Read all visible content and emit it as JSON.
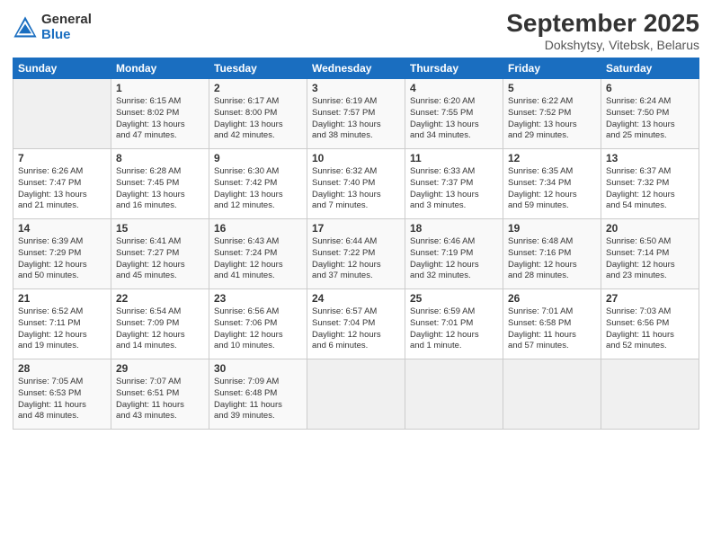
{
  "logo": {
    "general": "General",
    "blue": "Blue"
  },
  "title": "September 2025",
  "location": "Dokshytsy, Vitebsk, Belarus",
  "headers": [
    "Sunday",
    "Monday",
    "Tuesday",
    "Wednesday",
    "Thursday",
    "Friday",
    "Saturday"
  ],
  "weeks": [
    [
      {
        "day": "",
        "content": ""
      },
      {
        "day": "1",
        "content": "Sunrise: 6:15 AM\nSunset: 8:02 PM\nDaylight: 13 hours\nand 47 minutes."
      },
      {
        "day": "2",
        "content": "Sunrise: 6:17 AM\nSunset: 8:00 PM\nDaylight: 13 hours\nand 42 minutes."
      },
      {
        "day": "3",
        "content": "Sunrise: 6:19 AM\nSunset: 7:57 PM\nDaylight: 13 hours\nand 38 minutes."
      },
      {
        "day": "4",
        "content": "Sunrise: 6:20 AM\nSunset: 7:55 PM\nDaylight: 13 hours\nand 34 minutes."
      },
      {
        "day": "5",
        "content": "Sunrise: 6:22 AM\nSunset: 7:52 PM\nDaylight: 13 hours\nand 29 minutes."
      },
      {
        "day": "6",
        "content": "Sunrise: 6:24 AM\nSunset: 7:50 PM\nDaylight: 13 hours\nand 25 minutes."
      }
    ],
    [
      {
        "day": "7",
        "content": "Sunrise: 6:26 AM\nSunset: 7:47 PM\nDaylight: 13 hours\nand 21 minutes."
      },
      {
        "day": "8",
        "content": "Sunrise: 6:28 AM\nSunset: 7:45 PM\nDaylight: 13 hours\nand 16 minutes."
      },
      {
        "day": "9",
        "content": "Sunrise: 6:30 AM\nSunset: 7:42 PM\nDaylight: 13 hours\nand 12 minutes."
      },
      {
        "day": "10",
        "content": "Sunrise: 6:32 AM\nSunset: 7:40 PM\nDaylight: 13 hours\nand 7 minutes."
      },
      {
        "day": "11",
        "content": "Sunrise: 6:33 AM\nSunset: 7:37 PM\nDaylight: 13 hours\nand 3 minutes."
      },
      {
        "day": "12",
        "content": "Sunrise: 6:35 AM\nSunset: 7:34 PM\nDaylight: 12 hours\nand 59 minutes."
      },
      {
        "day": "13",
        "content": "Sunrise: 6:37 AM\nSunset: 7:32 PM\nDaylight: 12 hours\nand 54 minutes."
      }
    ],
    [
      {
        "day": "14",
        "content": "Sunrise: 6:39 AM\nSunset: 7:29 PM\nDaylight: 12 hours\nand 50 minutes."
      },
      {
        "day": "15",
        "content": "Sunrise: 6:41 AM\nSunset: 7:27 PM\nDaylight: 12 hours\nand 45 minutes."
      },
      {
        "day": "16",
        "content": "Sunrise: 6:43 AM\nSunset: 7:24 PM\nDaylight: 12 hours\nand 41 minutes."
      },
      {
        "day": "17",
        "content": "Sunrise: 6:44 AM\nSunset: 7:22 PM\nDaylight: 12 hours\nand 37 minutes."
      },
      {
        "day": "18",
        "content": "Sunrise: 6:46 AM\nSunset: 7:19 PM\nDaylight: 12 hours\nand 32 minutes."
      },
      {
        "day": "19",
        "content": "Sunrise: 6:48 AM\nSunset: 7:16 PM\nDaylight: 12 hours\nand 28 minutes."
      },
      {
        "day": "20",
        "content": "Sunrise: 6:50 AM\nSunset: 7:14 PM\nDaylight: 12 hours\nand 23 minutes."
      }
    ],
    [
      {
        "day": "21",
        "content": "Sunrise: 6:52 AM\nSunset: 7:11 PM\nDaylight: 12 hours\nand 19 minutes."
      },
      {
        "day": "22",
        "content": "Sunrise: 6:54 AM\nSunset: 7:09 PM\nDaylight: 12 hours\nand 14 minutes."
      },
      {
        "day": "23",
        "content": "Sunrise: 6:56 AM\nSunset: 7:06 PM\nDaylight: 12 hours\nand 10 minutes."
      },
      {
        "day": "24",
        "content": "Sunrise: 6:57 AM\nSunset: 7:04 PM\nDaylight: 12 hours\nand 6 minutes."
      },
      {
        "day": "25",
        "content": "Sunrise: 6:59 AM\nSunset: 7:01 PM\nDaylight: 12 hours\nand 1 minute."
      },
      {
        "day": "26",
        "content": "Sunrise: 7:01 AM\nSunset: 6:58 PM\nDaylight: 11 hours\nand 57 minutes."
      },
      {
        "day": "27",
        "content": "Sunrise: 7:03 AM\nSunset: 6:56 PM\nDaylight: 11 hours\nand 52 minutes."
      }
    ],
    [
      {
        "day": "28",
        "content": "Sunrise: 7:05 AM\nSunset: 6:53 PM\nDaylight: 11 hours\nand 48 minutes."
      },
      {
        "day": "29",
        "content": "Sunrise: 7:07 AM\nSunset: 6:51 PM\nDaylight: 11 hours\nand 43 minutes."
      },
      {
        "day": "30",
        "content": "Sunrise: 7:09 AM\nSunset: 6:48 PM\nDaylight: 11 hours\nand 39 minutes."
      },
      {
        "day": "",
        "content": ""
      },
      {
        "day": "",
        "content": ""
      },
      {
        "day": "",
        "content": ""
      },
      {
        "day": "",
        "content": ""
      }
    ]
  ]
}
